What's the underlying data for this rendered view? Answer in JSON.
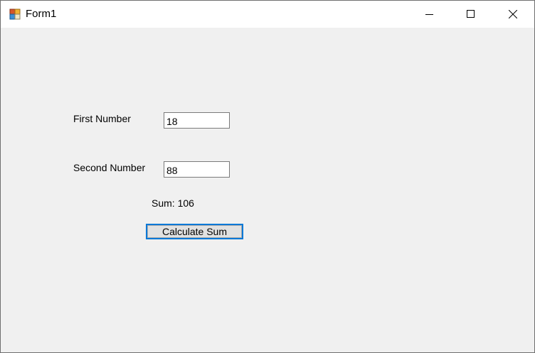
{
  "window": {
    "title": "Form1",
    "icon": "winforms-app-icon",
    "controls": {
      "minimize": "minimize-icon",
      "maximize": "maximize-icon",
      "close": "close-icon"
    }
  },
  "form": {
    "first_number": {
      "label": "First Number",
      "value": "18"
    },
    "second_number": {
      "label": "Second Number",
      "value": "88"
    },
    "sum_text": "Sum: 106",
    "calculate_button": "Calculate Sum"
  },
  "colors": {
    "form_background": "#f0f0f0",
    "titlebar_background": "#ffffff",
    "focus_border": "#0078d7",
    "button_face": "#e1e1e1"
  }
}
